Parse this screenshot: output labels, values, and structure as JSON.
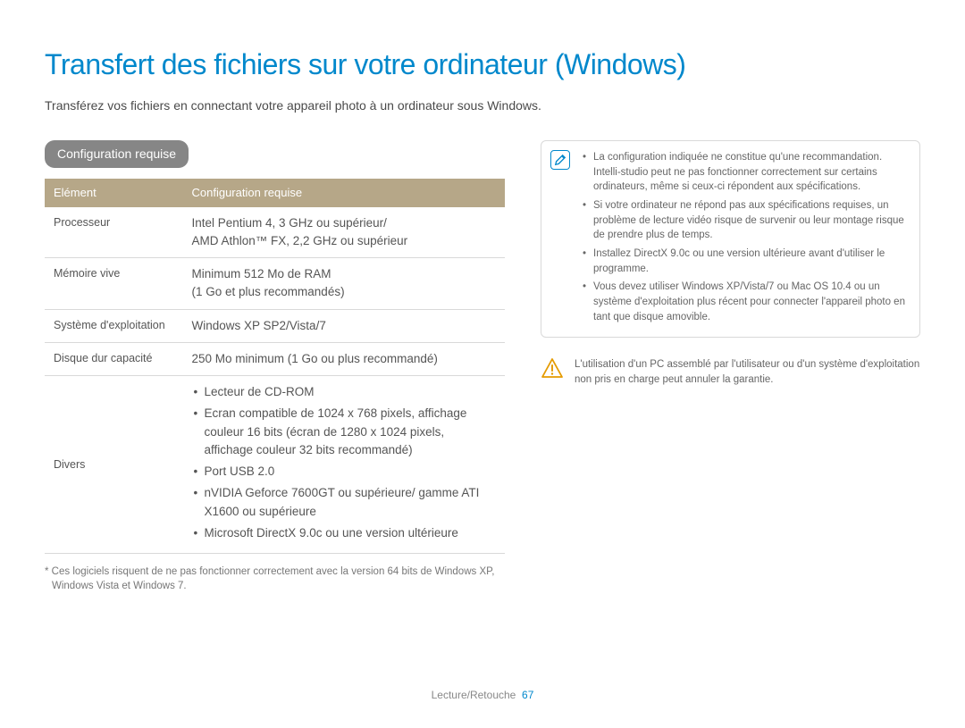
{
  "title": "Transfert des fichiers sur votre ordinateur (Windows)",
  "subtitle": "Transférez vos fichiers en connectant votre appareil photo à un ordinateur sous Windows.",
  "section_header": "Configuration requise",
  "table": {
    "headers": {
      "col1": "Elément",
      "col2": "Configuration requise"
    },
    "rows": {
      "r0": {
        "label": "Processeur",
        "value": "Intel Pentium 4, 3 GHz ou supérieur/\nAMD Athlon™ FX, 2,2 GHz ou supérieur"
      },
      "r1": {
        "label": "Mémoire vive",
        "value": "Minimum 512 Mo de RAM\n(1 Go et plus recommandés)"
      },
      "r2": {
        "label": "Système d'exploitation",
        "value": "Windows XP SP2/Vista/7"
      },
      "r3": {
        "label": "Disque dur capacité",
        "value": "250 Mo minimum (1 Go ou plus recommandé)"
      },
      "r4": {
        "label": "Divers",
        "items": {
          "i0": "Lecteur de CD-ROM",
          "i1": "Ecran compatible de 1024 x 768 pixels, affichage couleur 16 bits (écran de 1280 x 1024 pixels, affichage couleur 32 bits recommandé)",
          "i2": "Port USB 2.0",
          "i3": "nVIDIA Geforce 7600GT ou supérieure/ gamme ATI X1600 ou supérieure",
          "i4": "Microsoft DirectX 9.0c ou une version ultérieure"
        }
      }
    }
  },
  "footnote": "* Ces logiciels risquent de ne pas fonctionner correctement avec la version 64 bits de Windows XP, Windows Vista et Windows 7.",
  "note": {
    "items": {
      "n0": "La configuration indiquée ne constitue qu'une recommandation. Intelli-studio peut ne pas fonctionner correctement sur certains ordinateurs, même si ceux-ci répondent aux spécifications.",
      "n1": "Si votre ordinateur ne répond pas aux spécifications requises, un problème de lecture vidéo risque de survenir ou leur montage risque de prendre plus de temps.",
      "n2": "Installez DirectX 9.0c ou une version ultérieure avant d'utiliser le programme.",
      "n3": "Vous devez utiliser Windows XP/Vista/7 ou Mac OS 10.4 ou un système d'exploitation plus récent pour connecter l'appareil photo en tant que disque amovible."
    }
  },
  "warning": "L'utilisation d'un PC assemblé par l'utilisateur ou d'un système d'exploitation non pris en charge peut annuler la garantie.",
  "footer": {
    "section": "Lecture/Retouche",
    "page": "67"
  }
}
